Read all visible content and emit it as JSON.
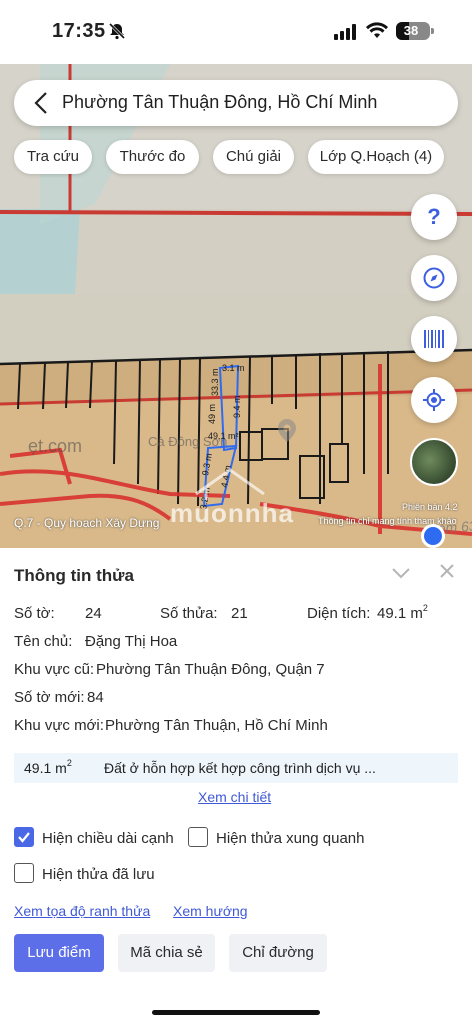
{
  "status_bar": {
    "time": "17:35",
    "battery": "38",
    "battery_level": 0.38
  },
  "search": {
    "location": "Phường Tân Thuận Đông, Hồ Chí Minh"
  },
  "chips": [
    {
      "label": "Tra cứu"
    },
    {
      "label": "Thước đo"
    },
    {
      "label": "Chú giải"
    },
    {
      "label": "Lớp Q.Hoạch (4)"
    }
  ],
  "fab_icons": [
    "help-icon",
    "compass-icon",
    "barcode-icon",
    "locate-icon"
  ],
  "map": {
    "help_symbol": "?",
    "caption": "Q.7 - Quy hoạch Xây Dựng",
    "version": "Phiên bản 4.2",
    "license": "Thông tin chỉ mang tính tham khảo",
    "watermark": "muonnha",
    "measurements": [
      "3.1 m",
      "33.3 m",
      "49 m",
      "9.4 m",
      "49.1 m²",
      "9.3 m",
      "4.4 m",
      "3.2 m"
    ],
    "street_labels": [
      "Hẻm 63",
      "Cà Đông Sơn",
      "ẹt.com"
    ]
  },
  "panel": {
    "title": "Thông tin thửa",
    "so_to_label": "Số tờ:",
    "so_to_value": "24",
    "so_thua_label": "Số thửa:",
    "so_thua_value": "21",
    "dien_tich_label": "Diện tích:",
    "dien_tich_value": "49.1 m",
    "owner_label": "Tên chủ:",
    "owner_value": "Đặng Thị Hoa",
    "old_area_label": "Khu vực cũ:",
    "old_area_value": "Phường Tân Thuận Đông, Quận 7",
    "new_sheet_label": "Số tờ mới:",
    "new_sheet_value": "84",
    "new_area_label": "Khu vực mới:",
    "new_area_value": "Phường Tân Thuận, Hồ Chí Minh",
    "land_area": "49.1 m",
    "land_use": "Đất ở hỗn hợp kết hợp công trình dịch vụ ...",
    "detail_link": "Xem chi tiết",
    "sup": "2",
    "options": [
      {
        "label": "Hiện chiều dài cạnh",
        "checked": true
      },
      {
        "label": "Hiện thửa xung quanh",
        "checked": false
      },
      {
        "label": "Hiện thửa đã lưu",
        "checked": false
      }
    ],
    "link_coords": "Xem tọa độ ranh thửa",
    "link_direction": "Xem hướng",
    "buttons": {
      "save": "Lưu điểm",
      "share": "Mã chia sẻ",
      "route": "Chỉ đường"
    }
  },
  "colors": {
    "accent": "#5c6ee8",
    "link": "#3f59d6",
    "boundary": "#d8342f",
    "plot": "#d9b98a"
  }
}
